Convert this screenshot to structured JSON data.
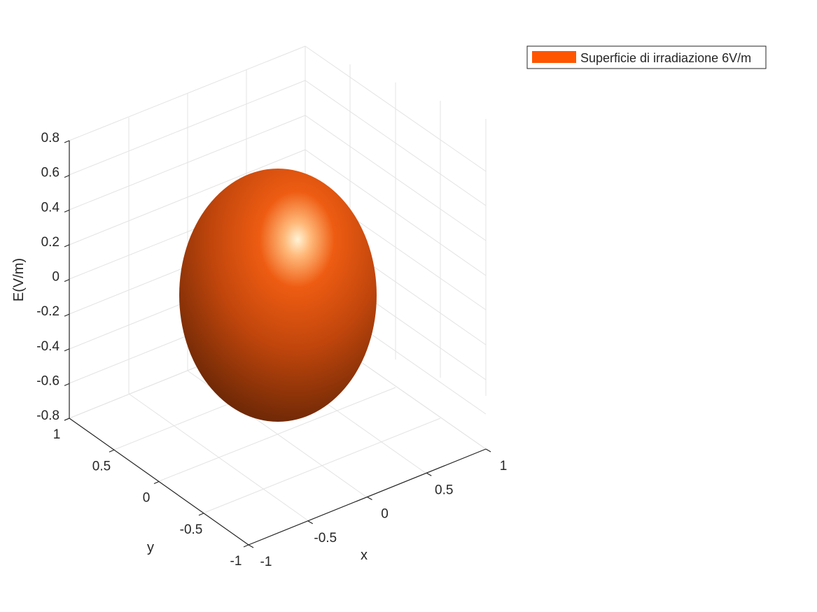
{
  "chart_data": {
    "type": "surface3d",
    "shape": "ellipsoid",
    "view": "3d-isometric",
    "grid": true,
    "legend": {
      "placement": "top-right",
      "entries": [
        {
          "label": "Superficie di irradiazione 6V/m",
          "color": "#FF5500"
        }
      ]
    },
    "axes": {
      "x": {
        "label": "x",
        "ticks": [
          "-1",
          "-0.5",
          "0",
          "0.5",
          "1"
        ],
        "range": [
          -1,
          1
        ]
      },
      "y": {
        "label": "y",
        "ticks": [
          "-1",
          "-0.5",
          "0",
          "0.5",
          "1"
        ],
        "range": [
          -1,
          1
        ]
      },
      "z": {
        "label": "E(V/m)",
        "ticks": [
          "-0.8",
          "-0.6",
          "-0.4",
          "-0.2",
          "0",
          "0.2",
          "0.4",
          "0.6",
          "0.8"
        ],
        "range": [
          -0.8,
          0.8
        ]
      }
    },
    "surface": {
      "semi_axis_x": 0.8,
      "semi_axis_y": 0.8,
      "semi_axis_z": 0.72,
      "color": "#FF5500"
    }
  }
}
